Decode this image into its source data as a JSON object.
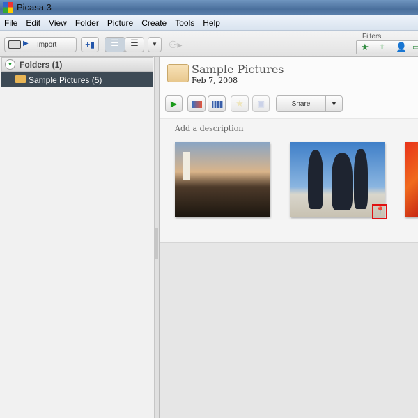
{
  "window": {
    "title": "Picasa 3"
  },
  "menu": [
    "File",
    "Edit",
    "View",
    "Folder",
    "Picture",
    "Create",
    "Tools",
    "Help"
  ],
  "toolbar": {
    "import_label": "Import",
    "filters_label": "Filters"
  },
  "sidebar": {
    "header": "Folders (1)",
    "items": [
      {
        "label": "Sample Pictures (5)",
        "selected": true
      }
    ]
  },
  "album": {
    "title": "Sample Pictures",
    "date": "Feb 7, 2008",
    "share_label": "Share",
    "description_placeholder": "Add a description"
  },
  "thumbnails": [
    {
      "subject": "lighthouse at sunset"
    },
    {
      "subject": "penguins",
      "geotag_highlighted": true
    },
    {
      "subject": "red flower (partial)"
    }
  ],
  "colors": {
    "selected_row": "#3d4a55",
    "highlight_box": "#e01010"
  }
}
